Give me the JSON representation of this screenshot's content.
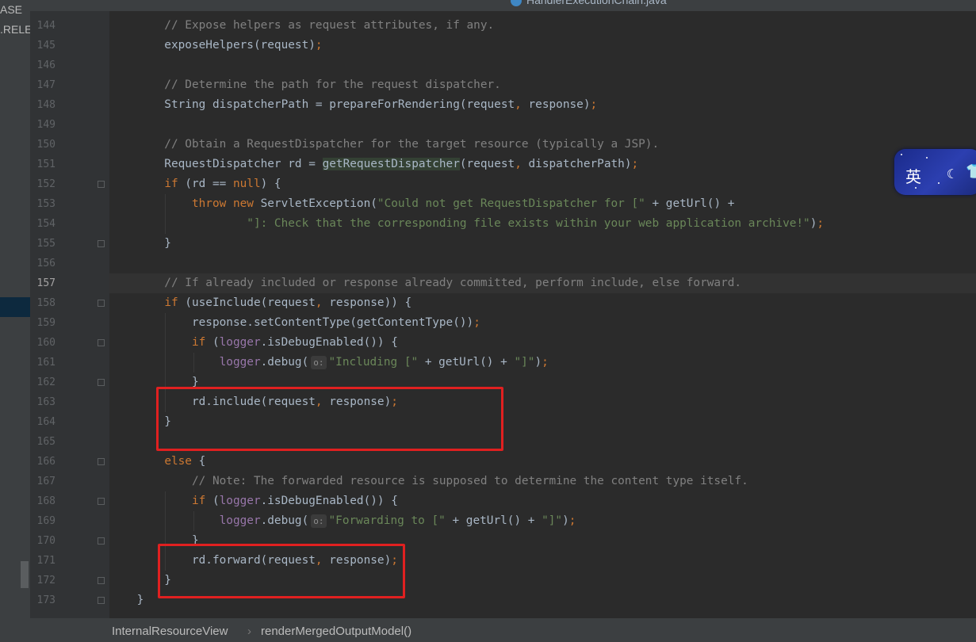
{
  "sidebar": {
    "labels": [
      "ASE",
      ".RELE"
    ]
  },
  "tab": {
    "title": "HandlerExecutionChain.java"
  },
  "breadcrumb": {
    "class": "InternalResourceView",
    "separator": "›",
    "method": "renderMergedOutputModel()"
  },
  "ime": {
    "lang_char": "英",
    "moon_glyph": "☾",
    "shirt_glyph": "👕"
  },
  "editor": {
    "current_line": "157",
    "lines": [
      {
        "n": "144",
        "t": "        // Expose helpers as request attributes, if any."
      },
      {
        "n": "145",
        "t": "        exposeHelpers(request);"
      },
      {
        "n": "146",
        "t": ""
      },
      {
        "n": "147",
        "t": "        // Determine the path for the request dispatcher."
      },
      {
        "n": "148",
        "t": "        String dispatcherPath = prepareForRendering(request, response);"
      },
      {
        "n": "149",
        "t": ""
      },
      {
        "n": "150",
        "t": "        // Obtain a RequestDispatcher for the target resource (typically a JSP)."
      },
      {
        "n": "151",
        "t": "        RequestDispatcher rd = getRequestDispatcher(request, dispatcherPath);"
      },
      {
        "n": "152",
        "t": "        if (rd == null) {"
      },
      {
        "n": "153",
        "t": "            throw new ServletException(\"Could not get RequestDispatcher for [\" + getUrl() +"
      },
      {
        "n": "154",
        "t": "                    \"]: Check that the corresponding file exists within your web application archive!\");"
      },
      {
        "n": "155",
        "t": "        }"
      },
      {
        "n": "156",
        "t": ""
      },
      {
        "n": "157",
        "t": "        // If already included or response already committed, perform include, else forward."
      },
      {
        "n": "158",
        "t": "        if (useInclude(request, response)) {"
      },
      {
        "n": "159",
        "t": "            response.setContentType(getContentType());"
      },
      {
        "n": "160",
        "t": "            if (logger.isDebugEnabled()) {"
      },
      {
        "n": "161",
        "t": "                logger.debug( o: \"Including [\" + getUrl() + \"]\");"
      },
      {
        "n": "162",
        "t": "            }"
      },
      {
        "n": "163",
        "t": "            rd.include(request, response);"
      },
      {
        "n": "164",
        "t": "        }"
      },
      {
        "n": "165",
        "t": ""
      },
      {
        "n": "166",
        "t": "        else {"
      },
      {
        "n": "167",
        "t": "            // Note: The forwarded resource is supposed to determine the content type itself."
      },
      {
        "n": "168",
        "t": "            if (logger.isDebugEnabled()) {"
      },
      {
        "n": "169",
        "t": "                logger.debug( o: \"Forwarding to [\" + getUrl() + \"]\");"
      },
      {
        "n": "170",
        "t": "            }"
      },
      {
        "n": "171",
        "t": "            rd.forward(request, response);"
      },
      {
        "n": "172",
        "t": "        }"
      },
      {
        "n": "173",
        "t": "    }"
      }
    ]
  },
  "colors": {
    "comment": "#808080",
    "keyword": "#cc7832",
    "string": "#6a8759",
    "field": "#9876aa",
    "text": "#a9b7c6",
    "annotation_box": "#e02020"
  }
}
